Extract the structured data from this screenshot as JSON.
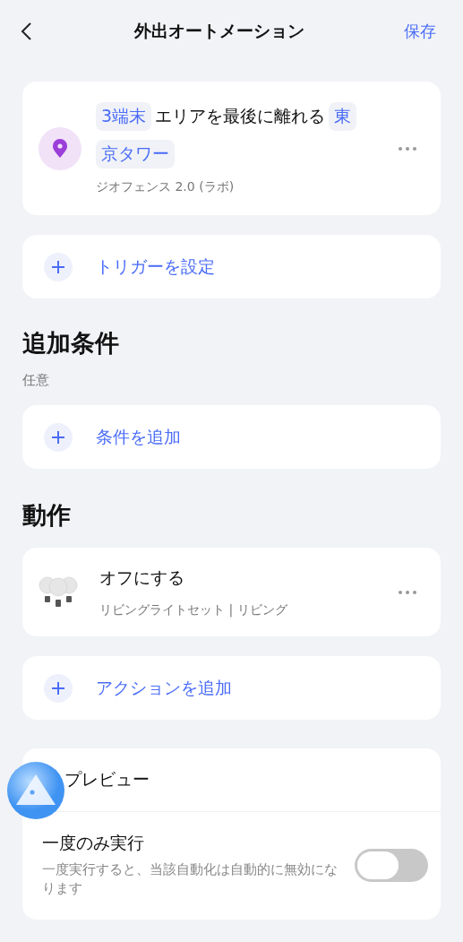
{
  "header": {
    "title": "外出オートメーション",
    "save": "保存"
  },
  "trigger": {
    "tokens": [
      {
        "text": "3端末",
        "kind": "chip"
      },
      {
        "text": "エリアを最後に離れる",
        "kind": "plain"
      },
      {
        "text": "東",
        "kind": "chip"
      },
      {
        "text": "京タワー",
        "kind": "chip"
      }
    ],
    "subtitle": "ジオフェンス 2.0 (ラボ)"
  },
  "add_trigger": {
    "label": "トリガーを設定"
  },
  "conditions": {
    "heading": "追加条件",
    "note": "任意",
    "add": {
      "label": "条件を追加"
    }
  },
  "actions": {
    "heading": "動作",
    "items": [
      {
        "title": "オフにする",
        "subtitle": "リビングライトセット | リビング"
      }
    ],
    "add": {
      "label": "アクションを追加"
    }
  },
  "settings": {
    "preview": "プレビュー",
    "run_once": {
      "title": "一度のみ実行",
      "description": "一度実行すると、当該自動化は自動的に無効になります",
      "on": false
    }
  }
}
